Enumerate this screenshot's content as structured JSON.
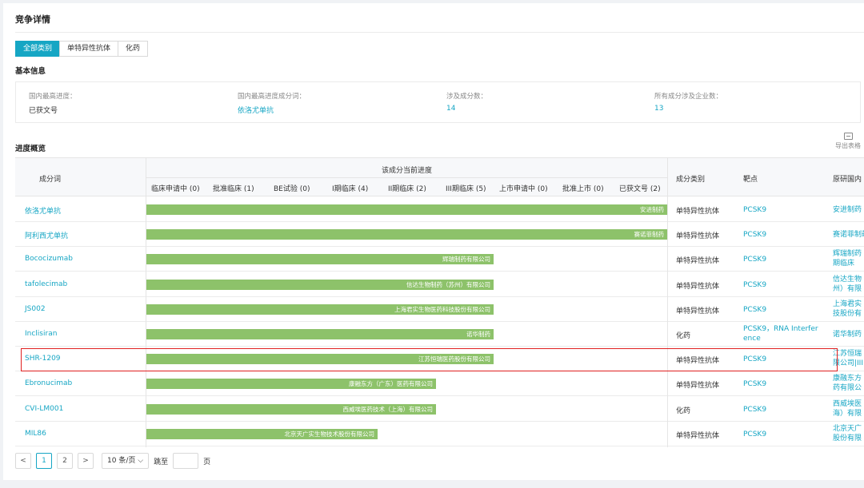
{
  "page": {
    "title": "竞争详情",
    "tabs": [
      "全部类别",
      "单特异性抗体",
      "化药"
    ]
  },
  "basic_info": {
    "section_title": "基本信息",
    "items": [
      {
        "label": "国内最高进度：",
        "value": "已获文号"
      },
      {
        "label": "国内最高进度成分词：",
        "value": "依洛尤单抗"
      },
      {
        "label": "涉及成分数：",
        "value": "14"
      },
      {
        "label": "所有成分涉及企业数：",
        "value": "13"
      }
    ]
  },
  "progress": {
    "section_title": "进度概览",
    "export_label": "导出表格",
    "columns": {
      "name": "成分词",
      "stage_group": "该成分当前进度",
      "stages": [
        "临床申请中 (0)",
        "批准临床 (1)",
        "BE试验 (0)",
        "I期临床 (4)",
        "II期临床 (2)",
        "III期临床 (5)",
        "上市申请中 (0)",
        "批准上市 (0)",
        "已获文号 (2)"
      ],
      "category": "成分类别",
      "target": "靶点",
      "org": "原研国内"
    },
    "rows": [
      {
        "name": "依洛尤单抗",
        "company": "安进制药",
        "stage_fraction": 1.0,
        "category": "单特异性抗体",
        "target": "PCSK9",
        "org": "安进制药"
      },
      {
        "name": "阿利西尤单抗",
        "company": "赛诺菲制药",
        "stage_fraction": 1.0,
        "category": "单特异性抗体",
        "target": "PCSK9",
        "org": "赛诺菲制药"
      },
      {
        "name": "Bococizumab",
        "company": "辉瑞制药有限公司",
        "stage_fraction": 0.667,
        "category": "单特异性抗体",
        "target": "PCSK9",
        "org": "辉瑞制药\n期临床"
      },
      {
        "name": "tafolecimab",
        "company": "信达生物制药（苏州）有限公司",
        "stage_fraction": 0.667,
        "category": "单特异性抗体",
        "target": "PCSK9",
        "org": "信达生物\n州）有限"
      },
      {
        "name": "JS002",
        "company": "上海君实生物医药科技股份有限公司",
        "stage_fraction": 0.667,
        "category": "单特异性抗体",
        "target": "PCSK9",
        "org": "上海君实\n技股份有"
      },
      {
        "name": "Inclisiran",
        "company": "诺华制药",
        "stage_fraction": 0.667,
        "category": "化药",
        "target": "PCSK9，RNA Interfer\nence",
        "org": "诺华制药"
      },
      {
        "name": "SHR-1209",
        "company": "江苏恒瑞医药股份有限公司",
        "stage_fraction": 0.667,
        "category": "单特异性抗体",
        "target": "PCSK9",
        "org": "江苏恒瑞\n限公司|III"
      },
      {
        "name": "Ebronucimab",
        "company": "康融东方（广东）医药有限公司",
        "stage_fraction": 0.556,
        "category": "单特异性抗体",
        "target": "PCSK9",
        "org": "康融东方\n药有限公"
      },
      {
        "name": "CVI-LM001",
        "company": "西威埃医药技术（上海）有限公司",
        "stage_fraction": 0.556,
        "category": "化药",
        "target": "PCSK9",
        "org": "西威埃医\n海）有限"
      },
      {
        "name": "MIL86",
        "company": "北京天广实生物技术股份有限公司",
        "stage_fraction": 0.444,
        "category": "单特异性抗体",
        "target": "PCSK9",
        "org": "北京天广\n股份有限"
      }
    ]
  },
  "pagination": {
    "prev": "<",
    "pages": [
      "1",
      "2"
    ],
    "next": ">",
    "page_size": "10 条/页",
    "jump_label": "跳至",
    "page_unit": "页"
  }
}
